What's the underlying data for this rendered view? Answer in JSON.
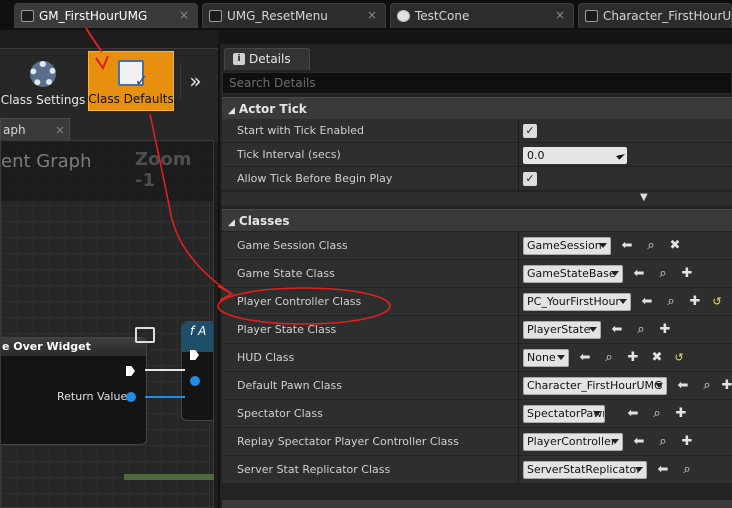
{
  "tabs": [
    {
      "label": "GM_FirstHourUMG",
      "active": true
    },
    {
      "label": "UMG_ResetMenu",
      "active": false
    },
    {
      "label": "TestCone",
      "active": false
    },
    {
      "label": "Character_FirstHourUMG",
      "active": false
    }
  ],
  "tab_close": "×",
  "toolbar": {
    "class_settings_label": "Class Settings",
    "class_defaults_label": "Class Defaults",
    "more": "»"
  },
  "graph": {
    "tab_label": "aph",
    "tab_close": "×",
    "title": "ent Graph",
    "zoom": "Zoom -1",
    "node_title": "e Over Widget",
    "return_value_label": "Return Value",
    "func_icon": "f",
    "func_letter": "A"
  },
  "details": {
    "tab_label": "Details",
    "search_placeholder": "Search Details",
    "categories": {
      "actor_tick": "Actor Tick",
      "classes": "Classes"
    },
    "actor_tick_rows": [
      {
        "label": "Start with Tick Enabled",
        "type": "checkbox",
        "checked": true
      },
      {
        "label": "Tick Interval (secs)",
        "type": "number",
        "value": "0.0"
      },
      {
        "label": "Allow Tick Before Begin Play",
        "type": "checkbox",
        "checked": true
      }
    ],
    "class_rows": [
      {
        "label": "Game Session Class",
        "value": "GameSession",
        "actions": [
          "arrow-left",
          "browse",
          "clear"
        ]
      },
      {
        "label": "Game State Class",
        "value": "GameStateBase",
        "actions": [
          "arrow-left",
          "browse",
          "add"
        ]
      },
      {
        "label": "Player Controller Class",
        "value": "PC_YourFirstHour",
        "actions": [
          "arrow-left",
          "browse",
          "add",
          "reset"
        ]
      },
      {
        "label": "Player State Class",
        "value": "PlayerState",
        "actions": [
          "arrow-left",
          "browse",
          "add"
        ]
      },
      {
        "label": "HUD Class",
        "value": "None",
        "actions": [
          "arrow-left",
          "browse",
          "add",
          "clear",
          "reset"
        ]
      },
      {
        "label": "Default Pawn Class",
        "value": "Character_FirstHourUMG",
        "actions": [
          "arrow-left",
          "browse",
          "add"
        ]
      },
      {
        "label": "Spectator Class",
        "value": "SpectatorPawn",
        "actions": [
          "arrow-left",
          "browse",
          "add"
        ]
      },
      {
        "label": "Replay Spectator Player Controller Class",
        "value": "PlayerController",
        "actions": [
          "arrow-left",
          "browse",
          "add"
        ]
      },
      {
        "label": "Server Stat Replicator Class",
        "value": "ServerStatReplicator",
        "actions": [
          "arrow-left",
          "browse"
        ]
      }
    ],
    "checkmark": "✓",
    "expand_arrow": "▼",
    "category_arrow": "◢"
  },
  "colors": {
    "accent_orange": "#e7900f",
    "annotation_red": "#e02020",
    "dropdown_bg": "#e3e3e3",
    "reset_yellow": "#f0e05a"
  }
}
